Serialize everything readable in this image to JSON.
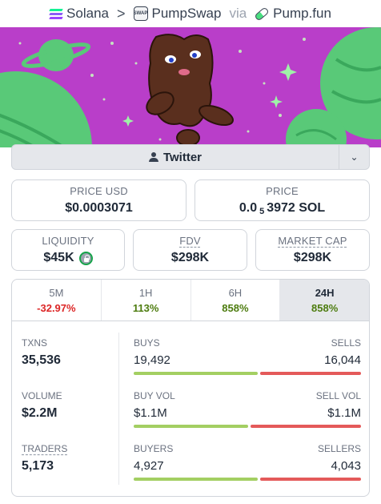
{
  "breadcrumb": {
    "chain": "Solana",
    "separator": ">",
    "dex": "PumpSwap",
    "dex_icon_text": "SWAP",
    "via": "via",
    "launchpad": "Pump.fun"
  },
  "colors": {
    "banner_bg": "#b93ec9",
    "planet": "#59c978",
    "negative": "#dc2626",
    "positive": "#4d7c0f",
    "buy_bar": "#a3cf62",
    "sell_bar": "#e45a5a"
  },
  "socials": {
    "twitter_label": "Twitter",
    "expand_icon": "chevron-down-icon"
  },
  "price": {
    "usd_label": "PRICE USD",
    "usd_value": "$0.0003071",
    "native_label": "PRICE",
    "native_prefix": "0.0",
    "native_zeros": "5",
    "native_suffix": "3972 SOL"
  },
  "metrics": {
    "liquidity_label": "LIQUIDITY",
    "liquidity_value": "$45K",
    "fdv_label": "FDV",
    "fdv_value": "$298K",
    "mcap_label": "MARKET CAP",
    "mcap_value": "$298K"
  },
  "tabs": [
    {
      "label": "5M",
      "value": "-32.97%"
    },
    {
      "label": "1H",
      "value": "113%"
    },
    {
      "label": "6H",
      "value": "858%"
    },
    {
      "label": "24H",
      "value": "858%"
    }
  ],
  "active_tab": "24H",
  "stats": {
    "txns_label": "TXNS",
    "txns_value": "35,536",
    "buys_label": "BUYS",
    "buys_value": "19,492",
    "sells_label": "SELLS",
    "sells_value": "16,044",
    "volume_label": "VOLUME",
    "volume_value": "$2.2M",
    "buy_vol_label": "BUY VOL",
    "buy_vol_value": "$1.1M",
    "sell_vol_label": "SELL VOL",
    "sell_vol_value": "$1.1M",
    "traders_label": "TRADERS",
    "traders_value": "5,173",
    "buyers_label": "BUYERS",
    "buyers_value": "4,927",
    "sellers_label": "SELLERS",
    "sellers_value": "4,043"
  },
  "ratios": {
    "buys_share": 0.55,
    "buy_vol_share": 0.51,
    "buyers_share": 0.55
  }
}
